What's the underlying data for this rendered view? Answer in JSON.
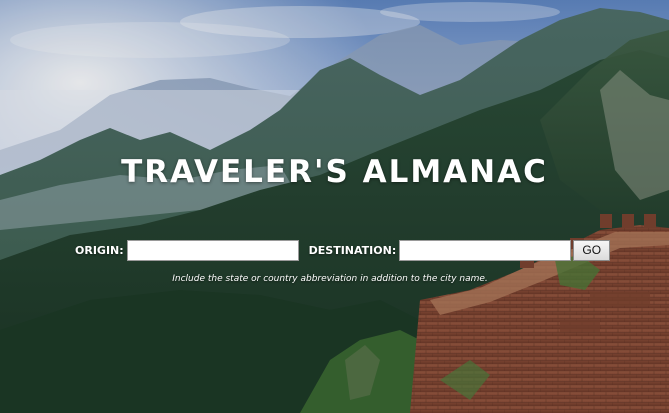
{
  "page": {
    "title": "TRAVELER'S ALMANAC"
  },
  "search_form": {
    "origin_label": "ORIGIN:",
    "origin_value": "",
    "origin_placeholder": "",
    "destination_label": "DESTINATION:",
    "destination_value": "",
    "destination_placeholder": "",
    "go_label": "GO",
    "hint": "Include the state or country abbreviation in addition to the city name."
  },
  "background": {
    "scene": "great-wall-mountains-photo",
    "colors": {
      "sky_top": "#6d93c8",
      "haze": "#e9eef7",
      "mountain_far": "#7f97b4",
      "forest_dark": "#1f3b2c",
      "brick": "#8a4a35"
    }
  }
}
